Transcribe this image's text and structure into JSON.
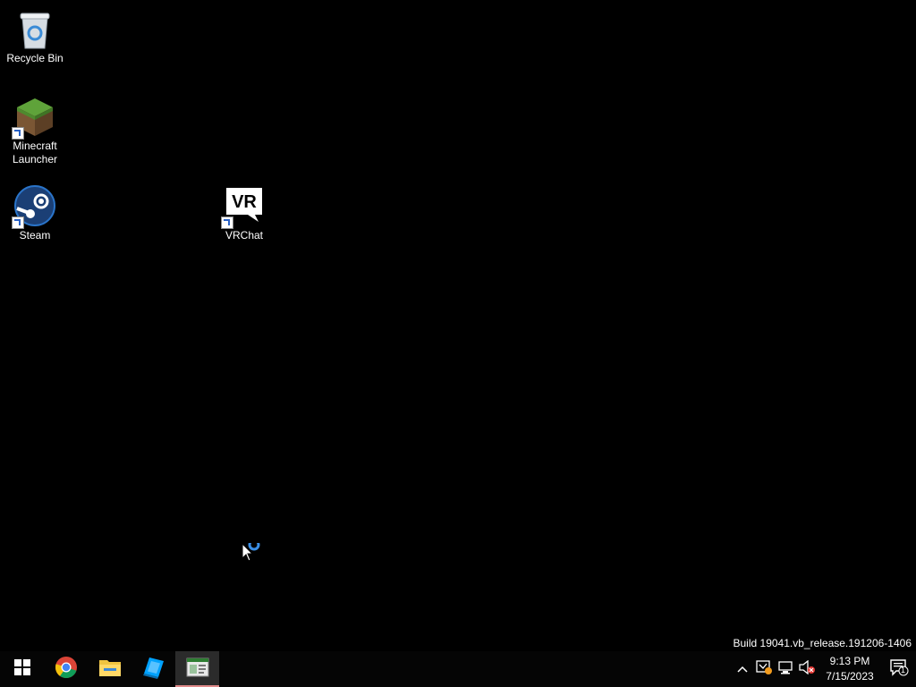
{
  "desktop": {
    "icons": [
      {
        "label": "Recycle Bin",
        "icon": "recycle-bin-icon"
      },
      {
        "label": "Minecraft Launcher",
        "icon": "minecraft-grass-block-icon"
      },
      {
        "label": "Steam",
        "icon": "steam-icon"
      },
      {
        "label": "VRChat",
        "icon": "vrchat-icon"
      }
    ],
    "watermark": "Build 19041.vb_release.191206-1406"
  },
  "taskbar": {
    "pinned": [
      {
        "name": "Start",
        "icon": "windows-logo-icon"
      },
      {
        "name": "Google Chrome",
        "icon": "chrome-icon"
      },
      {
        "name": "File Explorer",
        "icon": "folder-icon"
      },
      {
        "name": "Roblox Studio",
        "icon": "roblox-studio-icon"
      },
      {
        "name": "Running App",
        "icon": "app-window-icon",
        "active": true
      }
    ],
    "clock": {
      "time": "9:13 PM",
      "date": "7/15/2023"
    },
    "notifications": {
      "count": "1"
    }
  },
  "colors": {
    "accent": "#2a62c6",
    "active_underline": "#e08a8a"
  }
}
